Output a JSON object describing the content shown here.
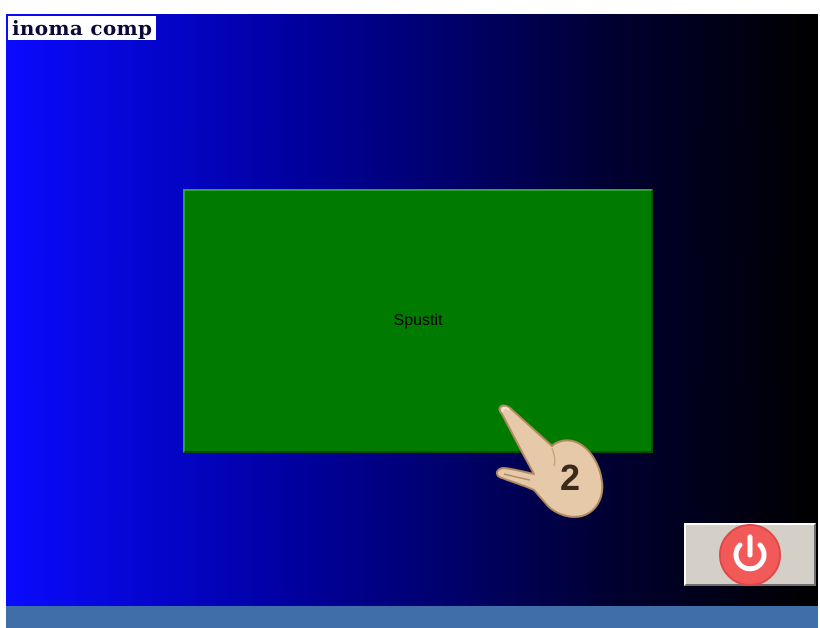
{
  "brand": {
    "text": "inoma comp"
  },
  "main": {
    "start_button_label": "Spustit"
  },
  "touch_hint": {
    "icon": "tap-hand-icon",
    "step_number": "2"
  },
  "power": {
    "icon": "power-icon",
    "color": "#f25a5a"
  },
  "colors": {
    "background_left": "#0a0aff",
    "background_right": "#000000",
    "start_button": "#007b00",
    "bottom_bar": "#3f6ea8"
  }
}
